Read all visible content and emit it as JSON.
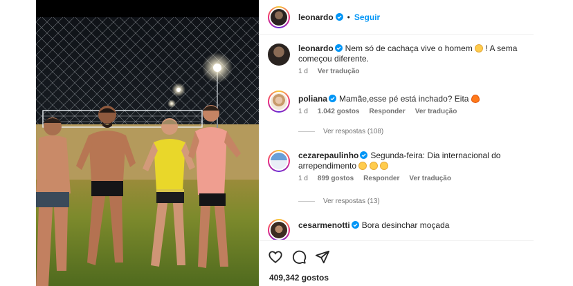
{
  "post": {
    "author": "leonardo",
    "follow_label": "Seguir",
    "caption_user": "leonardo",
    "caption_text": "Nem só de cachaça vive o homem",
    "caption_text_2": "! A sema",
    "caption_text_3": "começou diferente.",
    "caption_time": "1 d",
    "caption_translate": "Ver tradução",
    "likes": "409,342 gostos"
  },
  "comments": [
    {
      "user": "poliana",
      "text": "Mamãe,esse pé está inchado? Eita",
      "time": "1 d",
      "likes": "1.042 gostos",
      "reply": "Responder",
      "translate": "Ver tradução",
      "replies": "Ver respostas (108)"
    },
    {
      "user": "cezarepaulinho",
      "text": "Segunda-feira: Dia internacional do",
      "text_2": "arrependimento",
      "time": "1 d",
      "likes": "899 gostos",
      "reply": "Responder",
      "translate": "Ver tradução",
      "replies": "Ver respostas (13)"
    },
    {
      "user": "cesarmenotti",
      "text": "Bora desinchar moçada"
    }
  ],
  "icons": {
    "verified": "verified-badge-icon",
    "like": "heart-icon",
    "comment": "comment-icon",
    "share": "paper-plane-icon"
  },
  "colors": {
    "follow": "#0095f6",
    "verified": "#0095f6",
    "muted": "#737373"
  }
}
